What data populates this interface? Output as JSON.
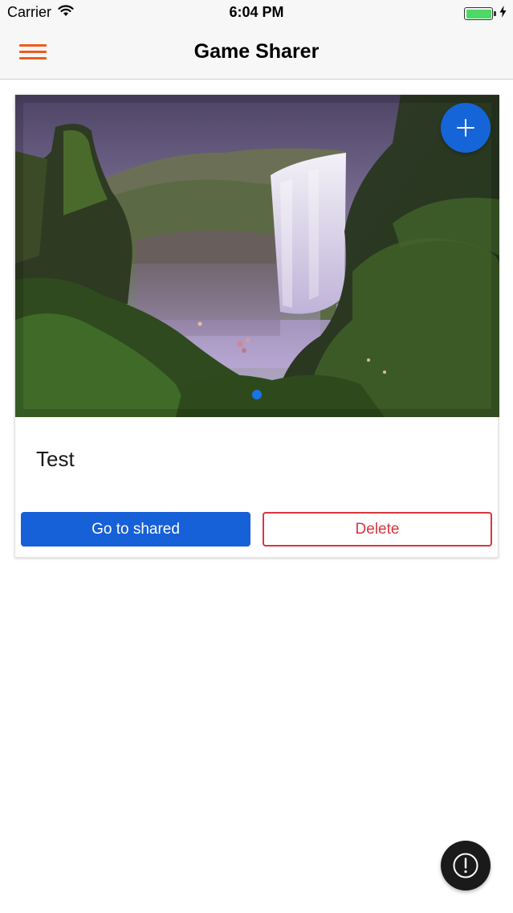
{
  "status_bar": {
    "carrier": "Carrier",
    "time": "6:04 PM",
    "battery_color": "#4cd964"
  },
  "nav": {
    "title": "Game Sharer",
    "menu_icon": "hamburger-menu-icon",
    "accent_color": "#f05a1e"
  },
  "card": {
    "image_description_icon": "waterfall-photo",
    "add_button_icon": "plus-icon",
    "title": "Test",
    "primary_button_label": "Go to shared",
    "danger_button_label": "Delete",
    "primary_color": "#1660d8",
    "danger_color": "#d9363e"
  },
  "fab": {
    "info_icon": "exclamation-circle-icon"
  }
}
